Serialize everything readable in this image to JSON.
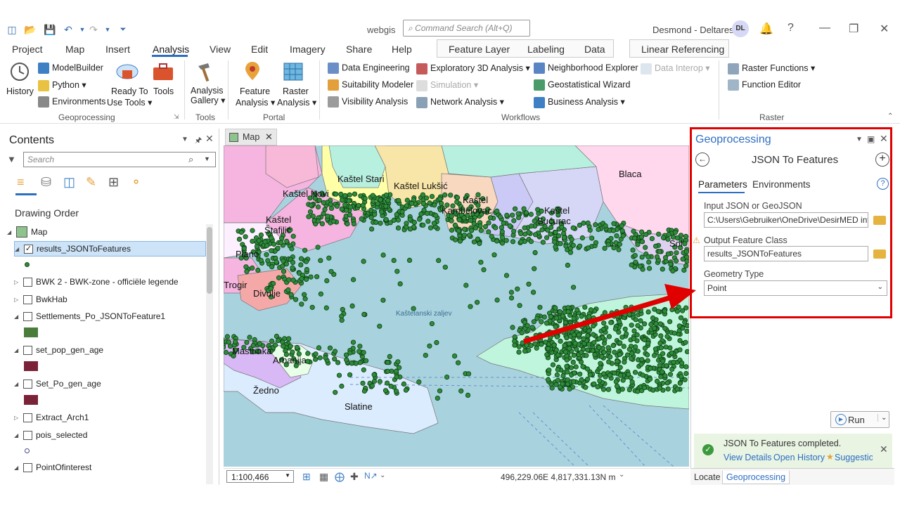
{
  "app": {
    "title": "webgis",
    "command_search_placeholder": "Command Search (Alt+Q)",
    "user": "Desmond - Deltares",
    "avatar_initials": "DL"
  },
  "ribbon_tabs": [
    "Project",
    "Map",
    "Insert",
    "Analysis",
    "View",
    "Edit",
    "Imagery",
    "Share",
    "Help",
    "Feature Layer",
    "Labeling",
    "Data",
    "Linear Referencing"
  ],
  "ribbon": {
    "geoprocessing": {
      "history": "History",
      "modelbuilder": "ModelBuilder",
      "python": "Python",
      "environments": "Environments",
      "ready_to_use_1": "Ready To",
      "ready_to_use_2": "Use Tools",
      "tools": "Tools",
      "label": "Geoprocessing"
    },
    "tools_group": {
      "analysis_gallery_1": "Analysis",
      "analysis_gallery_2": "Gallery",
      "label": "Tools"
    },
    "portal": {
      "feature_analysis_1": "Feature",
      "feature_analysis_2": "Analysis",
      "raster_analysis_1": "Raster",
      "raster_analysis_2": "Analysis",
      "label": "Portal"
    },
    "workflows": {
      "data_engineering": "Data Engineering",
      "suitability_modeler": "Suitability Modeler",
      "visibility_analysis": "Visibility Analysis",
      "exploratory_3d": "Exploratory 3D Analysis",
      "simulation": "Simulation",
      "network_analysis": "Network Analysis",
      "neighborhood_explorer": "Neighborhood Explorer",
      "geostatistical_wizard": "Geostatistical Wizard",
      "business_analysis": "Business Analysis",
      "data_interop": "Data Interop",
      "label": "Workflows"
    },
    "raster": {
      "raster_functions": "Raster Functions",
      "function_editor": "Function Editor",
      "label": "Raster"
    }
  },
  "contents": {
    "title": "Contents",
    "search_placeholder": "Search",
    "drawing_order": "Drawing Order",
    "map_root": "Map",
    "layers": [
      {
        "name": "results_JSONToFeatures",
        "checked": true,
        "swatch": "#2e8b3a"
      },
      {
        "name": "BWK 2 - BWK-zone - officiële legende",
        "checked": false
      },
      {
        "name": "BwkHab",
        "checked": false
      },
      {
        "name": "Settlements_Po_JSONToFeature1",
        "checked": false,
        "swatch": "#4a7d3a"
      },
      {
        "name": "set_pop_gen_age",
        "checked": false,
        "swatch": "#7a2238"
      },
      {
        "name": "Set_Po_gen_age",
        "checked": false,
        "swatch": "#7a2238"
      },
      {
        "name": "Extract_Arch1",
        "checked": false
      },
      {
        "name": "pois_selected",
        "checked": false
      },
      {
        "name": "PointOfinterest",
        "checked": false
      }
    ]
  },
  "map": {
    "tab_label": "Map",
    "scale": "1:100,466",
    "coordinates": "496,229.06E 4,817,331.13N m",
    "labels": {
      "kastel_stari": "Kaštel Stari",
      "kastel_luksic": "Kaštel Lukšić",
      "kastel_novi": "Kaštel Novi",
      "kastel_kambelovac_1": "Kaštel",
      "kastel_kambelovac_2": "Kambelovac",
      "kastel_sucurac_1": "Kaštel",
      "kastel_sucurac_2": "Sućurac",
      "kastel_stafilic_1": "Kaštel",
      "kastel_stafilic_2": "Štafilić",
      "plano": "Plano",
      "trogir": "Trogir",
      "divulje": "Divulje",
      "blaca": "Blaca",
      "bay": "Kaštelanski zaljev",
      "mastrinka": "Mastrinka",
      "arbanija": "Arbanija",
      "zedno": "Žedno",
      "slatine": "Slatine",
      "solin_partial": "Sol"
    }
  },
  "geoprocessing": {
    "pane_title": "Geoprocessing",
    "tool_title": "JSON To Features",
    "tab_parameters": "Parameters",
    "tab_environments": "Environments",
    "input_label": "Input JSON or GeoJSON",
    "input_value": "C:\\Users\\Gebruiker\\OneDrive\\DesirMED inf",
    "output_label": "Output Feature Class",
    "output_value": "results_JSONToFeatures",
    "geometry_label": "Geometry Type",
    "geometry_value": "Point",
    "run_label": "Run",
    "message": "JSON To Features completed.",
    "view_details": "View Details",
    "open_history": "Open History",
    "suggestions": "Suggestio"
  },
  "bottom_tabs": {
    "locate": "Locate",
    "geoprocessing": "Geoprocessing"
  },
  "colors": {
    "accent": "#2d6ec2",
    "highlight": "#e00000",
    "water": "#a9d2df",
    "points": "#2e8b3a"
  }
}
